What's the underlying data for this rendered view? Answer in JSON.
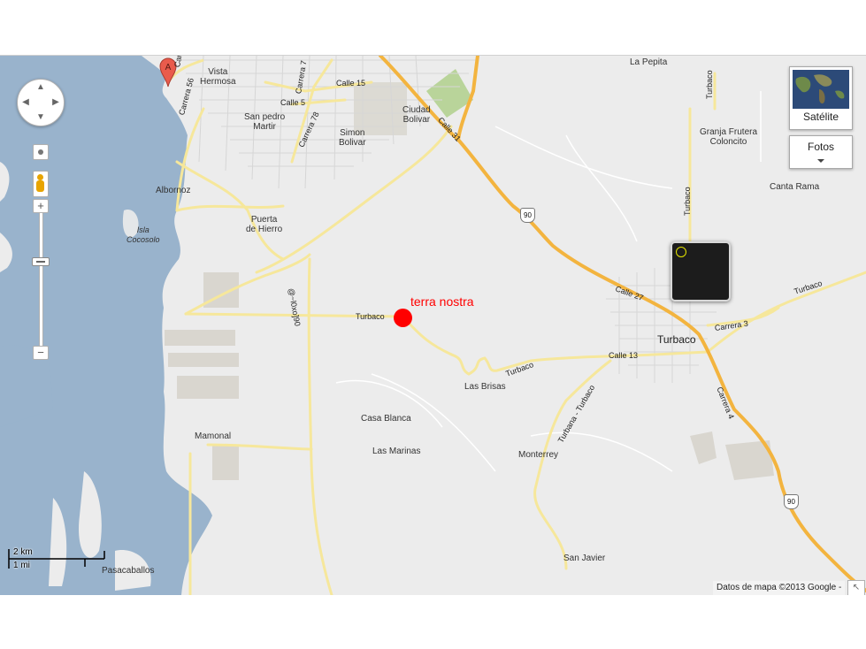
{
  "map": {
    "places": {
      "la_pepita": "La Pepita",
      "vista_hermosa": "Vista\nHermosa",
      "san_pedro_martir": "San pedro\nMartir",
      "ciudad_bolivar": "Ciudad\nBolivar",
      "simon_bolivar": "Simon\nBolivar",
      "granja_frutera": "Granja Frutera\nColoncito",
      "canta_rama": "Canta Rama",
      "albornoz": "Albornoz",
      "isla_cocosolo": "Isla\nCocosolo",
      "puerta_de_hierro": "Puerta\nde Hierro",
      "turbaco": "Turbaco",
      "las_brisas": "Las Brisas",
      "casa_blanca": "Casa Blanca",
      "las_marinas": "Las Marinas",
      "mamonal": "Mamonal",
      "monterrey": "Monterrey",
      "san_javier": "San Javier",
      "pasacaballos": "Pasacaballos"
    },
    "roads": {
      "carrera_56": "Carrera 56",
      "calle_57": "Carrera 57",
      "carrera_7": "Carrera 7",
      "calle_15": "Calle 15",
      "calle_5": "Calle 5",
      "carrera_78": "Carrera 78",
      "calle_31": "Calle 31",
      "turbaco_north": "Turbaco",
      "calle_27": "Calle 27",
      "carrera_3": "Carrera 3",
      "turbaco_east": "Turbaco",
      "turbaco_road": "Turbaco",
      "turbaco_road2": "Turbaco",
      "calle_13": "Calle 13",
      "turbana_turbaco": "Turbana - Turbaco",
      "carrera_4": "Carrera 4",
      "vertical_road": "@~l0xo]90"
    },
    "route_shields": [
      "90",
      "90"
    ],
    "marker_a": "A",
    "poi_label": "terra nostra",
    "poi_color": "#ff0000",
    "water_color": "#99b3cc",
    "land_color": "#ececec",
    "major_road_color": "#f3b43f",
    "minor_road_color": "#f6e79b"
  },
  "controls": {
    "satellite_label": "Satélite",
    "photos_label": "Fotos",
    "zoom_in": "+",
    "zoom_out": "−"
  },
  "scale": {
    "km": "2 km",
    "mi": "1 mi"
  },
  "attribution": "Datos de mapa ©2013 Google -",
  "corner_icon": "↖"
}
